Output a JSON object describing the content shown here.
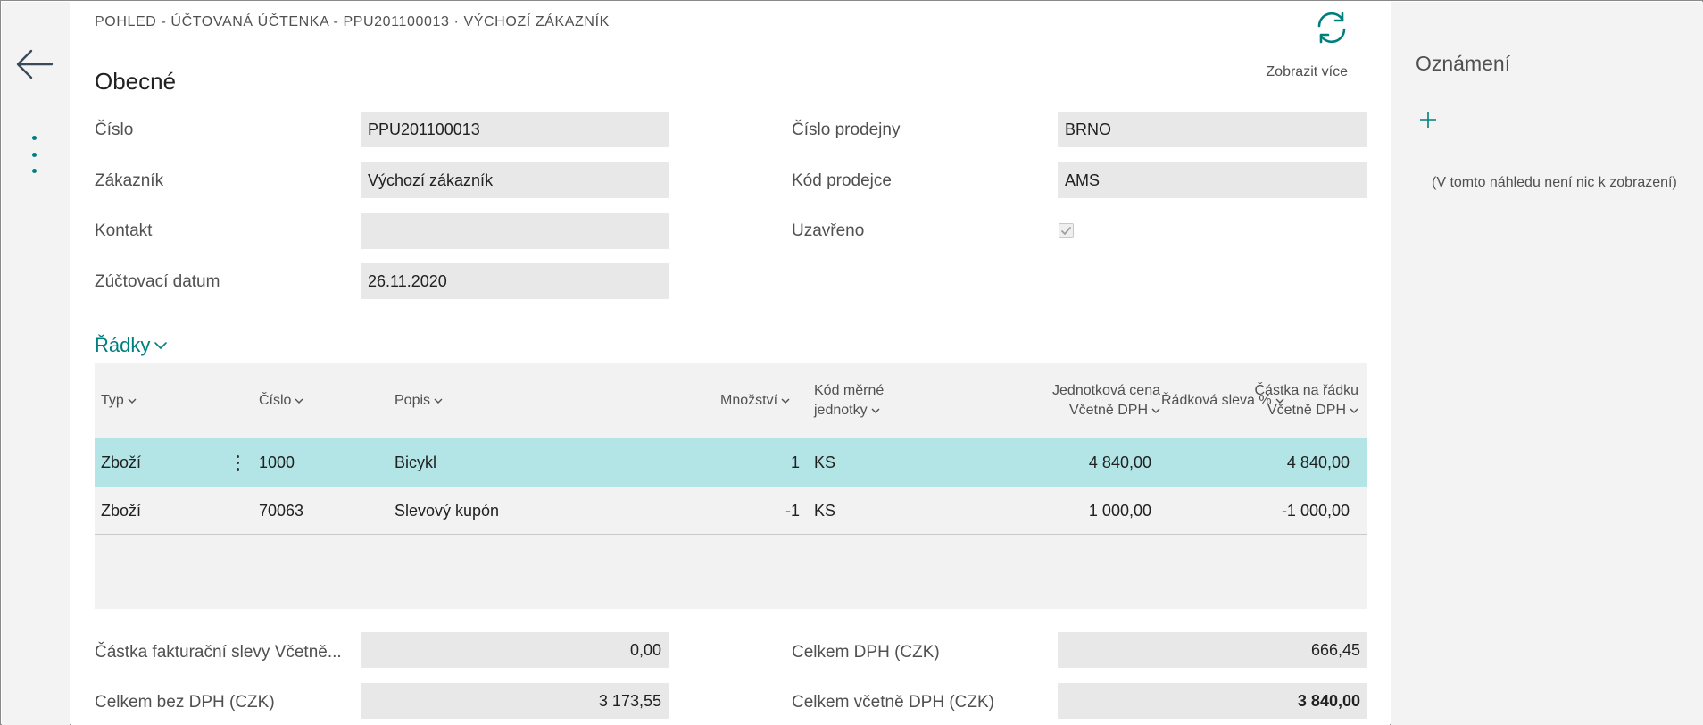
{
  "breadcrumb": "POHLED - ÚČTOVANÁ ÚČTENKA - PPU201100013 · VÝCHOZÍ ZÁKAZNÍK",
  "general": {
    "title": "Obecné",
    "show_more": "Zobrazit více",
    "fields": {
      "number": {
        "label": "Číslo",
        "value": "PPU201100013"
      },
      "customer": {
        "label": "Zákazník",
        "value": "Výchozí zákazník"
      },
      "contact": {
        "label": "Kontakt",
        "value": ""
      },
      "posting_date": {
        "label": "Zúčtovací datum",
        "value": "26.11.2020"
      },
      "store_no": {
        "label": "Číslo prodejny",
        "value": "BRNO"
      },
      "salesperson": {
        "label": "Kód prodejce",
        "value": "AMS"
      },
      "closed": {
        "label": "Uzavřeno",
        "checked": true
      }
    }
  },
  "lines": {
    "title": "Řádky",
    "columns": {
      "type": "Typ",
      "no": "Číslo",
      "description": "Popis",
      "quantity": "Množství",
      "uom_1": "Kód měrné",
      "uom_2": "jednotky",
      "unit_price_1": "Jednotková cena",
      "unit_price_2": "Včetně DPH",
      "line_discount": "Řádková sleva %",
      "line_amount_1": "Částka na řádku",
      "line_amount_2": "Včetně DPH"
    },
    "rows": [
      {
        "type": "Zboží",
        "no": "1000",
        "description": "Bicykl",
        "quantity": "1",
        "uom": "KS",
        "unit_price": "4 840,00",
        "line_discount": "",
        "line_amount": "4 840,00"
      },
      {
        "type": "Zboží",
        "no": "70063",
        "description": "Slevový kupón",
        "quantity": "-1",
        "uom": "KS",
        "unit_price": "1 000,00",
        "line_discount": "",
        "line_amount": "-1 000,00"
      }
    ]
  },
  "totals": {
    "invoice_discount": {
      "label": "Částka fakturační slevy Včetně...",
      "value": "0,00"
    },
    "total_excl_vat": {
      "label": "Celkem bez DPH (CZK)",
      "value": "3 173,55"
    },
    "total_vat": {
      "label": "Celkem DPH (CZK)",
      "value": "666,45"
    },
    "total_incl_vat": {
      "label": "Celkem včetně DPH (CZK)",
      "value": "3 840,00"
    }
  },
  "notifications": {
    "title": "Oznámení",
    "empty_text": "(V tomto náhledu není nic k zobrazení)"
  },
  "colors": {
    "accent": "#00807d",
    "selected_row": "#b3e5e7",
    "field_bg": "#e8e8e9",
    "panel_bg": "#f3f3f3"
  }
}
